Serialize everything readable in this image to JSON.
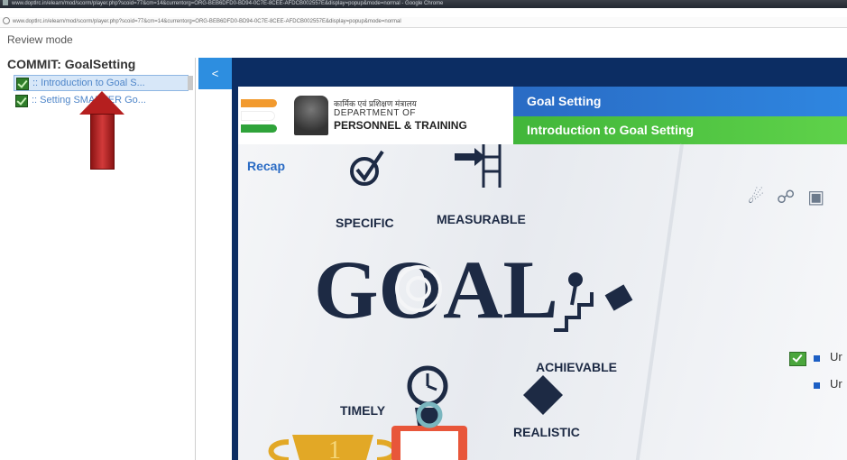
{
  "window": {
    "title": "www.doptlrc.in/elearn/mod/scorm/player.php?scoid=77&cm=14&currentorg=ORG-BEB6DFD0-BD94-0C7E-8CEE-AFDCB002557E&display=popup&mode=normal - Google Chrome",
    "url": "www.doptlrc.in/elearn/mod/scorm/player.php?scoid=77&cm=14&currentorg=ORG-BEB6DFD0-BD94-0C7E-8CEE-AFDCB002557E&display=popup&mode=normal"
  },
  "review_mode": "Review mode",
  "toc": {
    "title": "COMMIT: GoalSetting",
    "items": [
      {
        "label": ":: Introduction to Goal S...",
        "icon": "completed-check-icon",
        "selected": true
      },
      {
        "label": ":: Setting SMARTER Go...",
        "icon": "completed-check-icon",
        "selected": false
      }
    ]
  },
  "collapse_button": "<",
  "slide": {
    "dept_hindi": "कार्मिक एवं प्रशिक्षण मंत्रालय",
    "dept_line1": "DEPARTMENT OF",
    "dept_line2": "PERSONNEL & TRAINING",
    "header_title": "Goal Setting",
    "header_subtitle": "Introduction to Goal Setting",
    "section_label": "Recap",
    "art_words": {
      "specific": "SPECIFIC",
      "measurable": "MEASURABLE",
      "goal": "GOAL",
      "achievable": "ACHIEVABLE",
      "timely": "TIMELY",
      "realistic": "REALISTIC",
      "trophy_number": "1"
    },
    "bullets": [
      "Ur",
      "Ur"
    ]
  },
  "colors": {
    "accent_blue": "#2d8ee0",
    "stage_navy": "#0c2d63",
    "header_blue": "#2a6bc4",
    "header_green": "#41b63a",
    "arrow_red": "#b51f1f"
  }
}
